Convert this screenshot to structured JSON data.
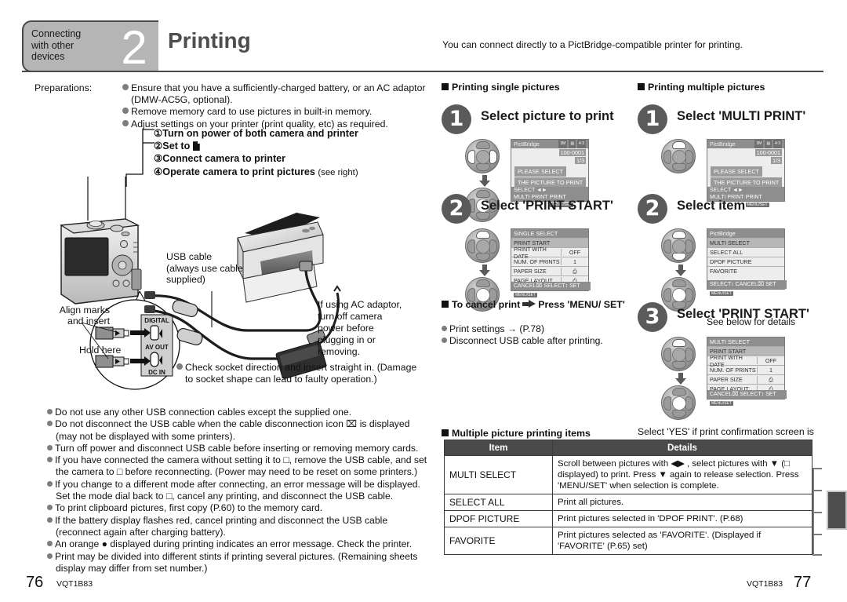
{
  "header": {
    "chapter_label": "Connecting\nwith other\ndevices",
    "chapter_number": "2",
    "title": "Printing",
    "note": "You can connect directly to a PictBridge-compatible printer for printing."
  },
  "preparations": {
    "label": "Preparations:",
    "items": [
      "Ensure that you have a sufficiently-charged battery, or an AC adaptor (DMW-AC5G, optional).",
      "Remove memory card to use pictures in built-in memory.",
      "Adjust settings on your printer (print quality, etc) as required."
    ]
  },
  "setup_steps": [
    "①Turn on power of both camera and printer",
    "②Set to ",
    "③Connect camera to printer",
    "④Operate camera to print pictures"
  ],
  "setup_steps_suffix": "(see right)",
  "diagram": {
    "usb_cable_label": "USB cable",
    "usb_cable_sub": "(always use cable supplied)",
    "ac_note": "If using AC adaptor,\nturn off camera\npower before\nplugging in or\nremoving.",
    "align_marks": "Align marks\nand insert",
    "hold_here": "Hold here",
    "port_digital": "DIGITAL",
    "port_avout": "AV OUT",
    "port_dcin": "DC IN",
    "socket_note": "Check socket direction and insert straight in. (Damage to socket shape can lead to faulty operation.)"
  },
  "left_notes": [
    "Do not use any other USB connection cables except the supplied one.",
    "Do not disconnect the USB cable when the cable disconnection icon ⌧ is displayed (may not be displayed with some printers).",
    "Turn off power and disconnect USB cable before inserting or removing memory cards.",
    "If you have connected the camera without setting it to □, remove the USB cable, and set the camera to □ before reconnecting. (Power may need to be reset on some printers.)",
    "If you change to a different mode after connecting, an error message will be displayed. Set the mode dial back to □, cancel any printing, and disconnect the USB cable.",
    "To print clipboard pictures, first copy (P.60) to the memory card.",
    "If the battery display flashes red, cancel printing and disconnect the USB cable (reconnect again after charging battery).",
    "An orange ● displayed during printing indicates an error message. Check the printer.",
    "Print may be divided into different stints if printing several pictures. (Remaining sheets display may differ from set number.)"
  ],
  "single": {
    "section_title": "Printing single pictures",
    "step1": {
      "num": "1",
      "label": "Select picture to print",
      "lcd": {
        "brand": "PictBridge",
        "badges": [
          "3M",
          "▤",
          "4:3"
        ],
        "file": "100-0001",
        "counter": "1/3",
        "msg_line1": "PLEASE SELECT",
        "msg_line2": "THE PICTURE TO PRINT",
        "bottom_left": "SELECT",
        "bottom_left2": "MULTI PRINT",
        "bottom_right": "PRINT",
        "bottom_right_key": "MENU/SET"
      }
    },
    "step2": {
      "num": "2",
      "label": "Select 'PRINT START'",
      "lcd": {
        "title": "SINGLE SELECT",
        "rows": [
          {
            "k": "PRINT START",
            "v": "",
            "selected": true
          },
          {
            "k": "PRINT WITH DATE",
            "v": "OFF",
            "selected": false
          },
          {
            "k": "NUM. OF PRINTS",
            "v": "1",
            "selected": false
          },
          {
            "k": "PAPER SIZE",
            "v": "⎙",
            "selected": false
          },
          {
            "k": "PAGE LAYOUT",
            "v": "⎙",
            "selected": false
          }
        ],
        "footer": "CANCEL⌧ SELECT↕ SET",
        "footer_key": "MENU/SET"
      }
    },
    "cancel": {
      "title_a": "To cancel print",
      "title_b": "Press 'MENU/ SET'",
      "notes": [
        "Print settings → (P.78)",
        "Disconnect USB cable after printing."
      ]
    }
  },
  "multiple": {
    "section_title": "Printing multiple pictures",
    "step1": {
      "num": "1",
      "label": "Select 'MULTI PRINT'",
      "lcd": {
        "brand": "PictBridge",
        "badges": [
          "3M",
          "▤",
          "4:3"
        ],
        "file": "100-0001",
        "counter": "1/3",
        "msg_line1": "PLEASE SELECT",
        "msg_line2": "THE PICTURE TO PRINT",
        "bottom_left": "SELECT",
        "bottom_left2": "MULTI PRINT",
        "bottom_right": "PRINT",
        "bottom_right_key": "MENU/SET"
      }
    },
    "step2": {
      "num": "2",
      "label": "Select item",
      "lcd": {
        "title": "PictBridge",
        "rows": [
          {
            "k": "MULTI SELECT",
            "v": "",
            "selected": true
          },
          {
            "k": "SELECT ALL",
            "v": "",
            "selected": false
          },
          {
            "k": "DPOF PICTURE",
            "v": "",
            "selected": false
          },
          {
            "k": "FAVORITE",
            "v": "",
            "selected": false
          }
        ],
        "footer": "SELECT↕ CANCEL⌧ SET",
        "footer_key": "MENU/SET"
      },
      "caption": "See below for details"
    },
    "step3": {
      "num": "3",
      "label": "Select 'PRINT START'",
      "lcd": {
        "title": "MULTI SELECT",
        "rows": [
          {
            "k": "PRINT START",
            "v": "",
            "selected": true
          },
          {
            "k": "PRINT WITH DATE",
            "v": "OFF",
            "selected": false
          },
          {
            "k": "NUM. OF PRINTS",
            "v": "1",
            "selected": false
          },
          {
            "k": "PAPER SIZE",
            "v": "⎙",
            "selected": false
          },
          {
            "k": "PAGE LAYOUT",
            "v": "⎙",
            "selected": false
          }
        ],
        "footer": "CANCEL⌧ SELECT↕ SET",
        "footer_key": "MENU/SET"
      },
      "caption": "Select 'YES' if print confirmation screen is displayed."
    }
  },
  "table": {
    "section_title": "Multiple picture printing items",
    "columns": [
      "Item",
      "Details"
    ],
    "rows": [
      {
        "item": "MULTI SELECT",
        "details": "Scroll between pictures with ◀▶ , select pictures with ▼ (□ displayed) to print. Press ▼ again to release selection. Press 'MENU/SET' when selection is complete."
      },
      {
        "item": "SELECT ALL",
        "details": "Print all pictures."
      },
      {
        "item": "DPOF PICTURE",
        "details": "Print pictures selected in 'DPOF PRINT'. (P.68)"
      },
      {
        "item": "FAVORITE",
        "details": "Print pictures selected as 'FAVORITE'. (Displayed if 'FAVORITE' (P.65) set)"
      }
    ]
  },
  "footer": {
    "left_page": "76",
    "left_code": "VQT1B83",
    "right_code": "VQT1B83",
    "right_page": "77"
  },
  "colors": {
    "header_gray": "#b5b5b5",
    "title_gray": "#4d4d4d",
    "table_header": "#4a4a4a",
    "step_circle": "#5a5a5a"
  }
}
